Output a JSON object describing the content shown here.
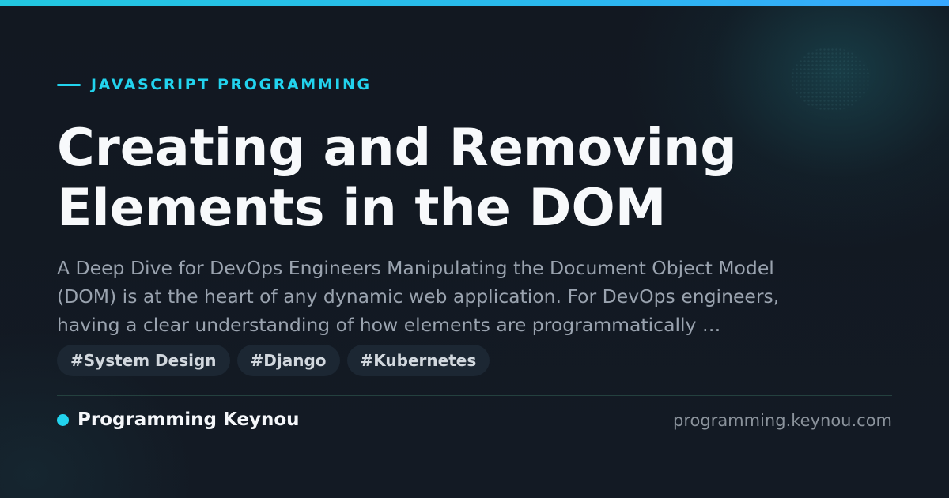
{
  "category": "JAVASCRIPT PROGRAMMING",
  "title_lines": [
    "Creating and Removing",
    "Elements in the DOM"
  ],
  "description_lines": [
    "A Deep Dive for DevOps Engineers Manipulating the Document Object Model",
    "(DOM) is at the heart of any dynamic web application. For DevOps engineers,",
    "having a clear understanding of how elements are programmatically …"
  ],
  "tags": [
    "#System Design",
    "#Django",
    "#Kubernetes"
  ],
  "footer": {
    "brand": "Programming Keynou",
    "url": "programming.keynou.com"
  },
  "colors": {
    "accent": "#22d3ee",
    "background": "#121821",
    "title": "#f7f9fb",
    "description": "#9aa3af",
    "tag_background": "#1c2733"
  }
}
